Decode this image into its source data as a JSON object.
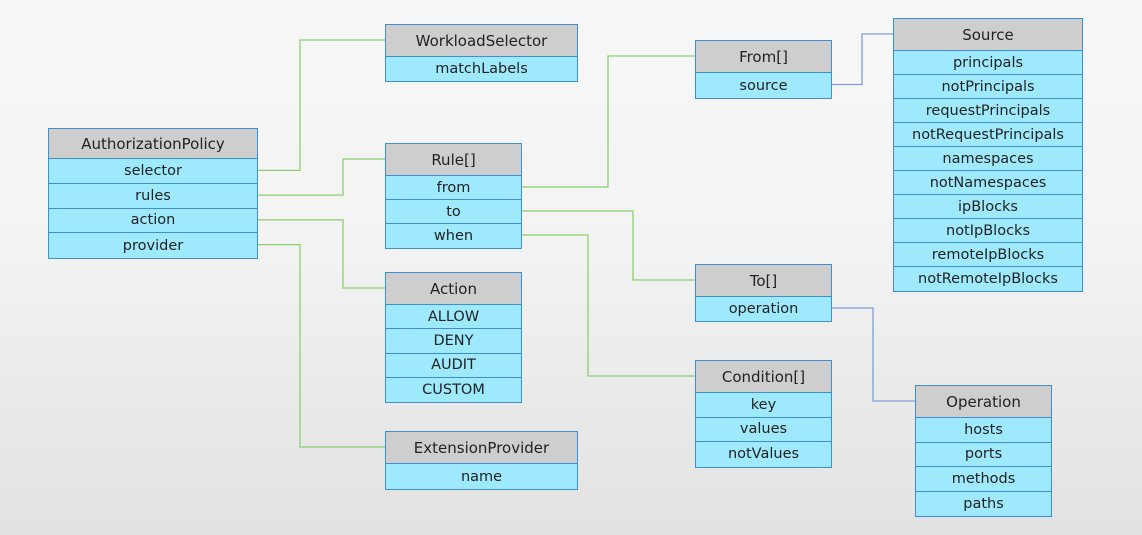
{
  "colors": {
    "header_fill": "#cfcecf",
    "field_fill": "#9eeafc",
    "border": "#3d8fd1",
    "link_green": "#8ccf6e",
    "link_blue": "#7f9fd8"
  },
  "boxes": [
    {
      "id": "authorization-policy",
      "title": "AuthorizationPolicy",
      "fields": [
        "selector",
        "rules",
        "action",
        "provider"
      ]
    },
    {
      "id": "workload-selector",
      "title": "WorkloadSelector",
      "fields": [
        "matchLabels"
      ]
    },
    {
      "id": "rule",
      "title": "Rule[]",
      "fields": [
        "from",
        "to",
        "when"
      ]
    },
    {
      "id": "action",
      "title": "Action",
      "fields": [
        "ALLOW",
        "DENY",
        "AUDIT",
        "CUSTOM"
      ]
    },
    {
      "id": "extension-provider",
      "title": "ExtensionProvider",
      "fields": [
        "name"
      ]
    },
    {
      "id": "from",
      "title": "From[]",
      "fields": [
        "source"
      ]
    },
    {
      "id": "to",
      "title": "To[]",
      "fields": [
        "operation"
      ]
    },
    {
      "id": "condition",
      "title": "Condition[]",
      "fields": [
        "key",
        "values",
        "notValues"
      ]
    },
    {
      "id": "source",
      "title": "Source",
      "fields": [
        "principals",
        "notPrincipals",
        "requestPrincipals",
        "notRequestPrincipals",
        "namespaces",
        "notNamespaces",
        "ipBlocks",
        "notIpBlocks",
        "remoteIpBlocks",
        "notRemoteIpBlocks"
      ]
    },
    {
      "id": "operation",
      "title": "Operation",
      "fields": [
        "hosts",
        "ports",
        "methods",
        "paths"
      ]
    }
  ],
  "links": [
    {
      "from": "authorization-policy.selector",
      "to": "workload-selector",
      "color": "green"
    },
    {
      "from": "authorization-policy.rules",
      "to": "rule",
      "color": "green"
    },
    {
      "from": "authorization-policy.action",
      "to": "action",
      "color": "green"
    },
    {
      "from": "authorization-policy.provider",
      "to": "extension-provider",
      "color": "green"
    },
    {
      "from": "rule.from",
      "to": "from",
      "color": "green"
    },
    {
      "from": "rule.to",
      "to": "to",
      "color": "green"
    },
    {
      "from": "rule.when",
      "to": "condition",
      "color": "green"
    },
    {
      "from": "from.source",
      "to": "source",
      "color": "blue"
    },
    {
      "from": "to.operation",
      "to": "operation",
      "color": "blue"
    }
  ]
}
